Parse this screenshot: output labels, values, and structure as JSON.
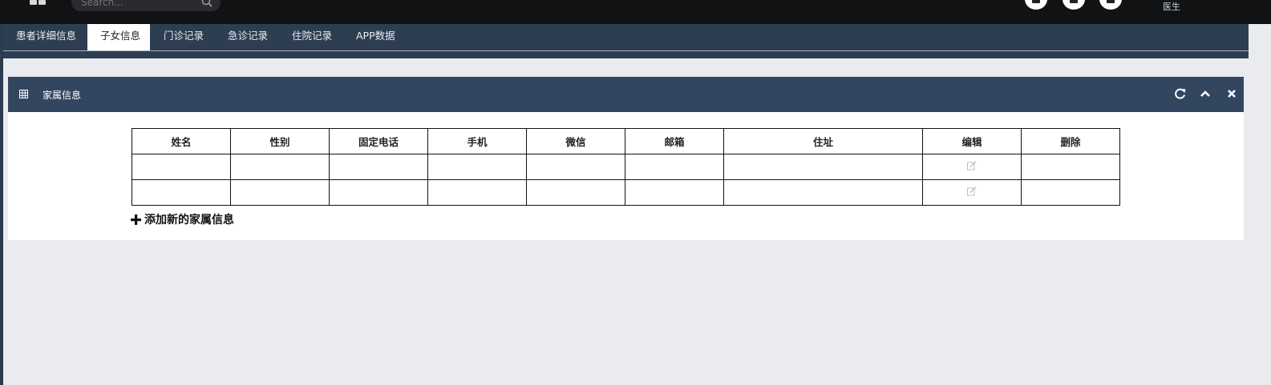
{
  "header": {
    "search_placeholder": "Search...",
    "user_role": "医生",
    "icons": [
      "grid-icon",
      "search-icon",
      "app-icon-1",
      "app-icon-2",
      "app-icon-3"
    ]
  },
  "tabs": [
    {
      "label": "患者详细信息",
      "active": false
    },
    {
      "label": "子女信息",
      "active": true
    },
    {
      "label": "门诊记录",
      "active": false
    },
    {
      "label": "急诊记录",
      "active": false
    },
    {
      "label": "住院记录",
      "active": false
    },
    {
      "label": "APP数据",
      "active": false
    }
  ],
  "panel": {
    "title": "家属信息",
    "icons": [
      "table-icon",
      "refresh-icon",
      "collapse-icon",
      "close-icon"
    ]
  },
  "table": {
    "columns": [
      "姓名",
      "性别",
      "固定电话",
      "手机",
      "微信",
      "邮箱",
      "住址",
      "编辑",
      "删除"
    ],
    "rows": [
      [
        "",
        "",
        "",
        "",
        "",
        "",
        "",
        "",
        ""
      ],
      [
        "",
        "",
        "",
        "",
        "",
        "",
        "",
        "",
        ""
      ]
    ],
    "edit_icon": "edit-icon"
  },
  "add_link": "添加新的家属信息",
  "colors": {
    "topbar": "#111214",
    "nav": "#2d3e52",
    "panel_header": "#33465f",
    "background": "#e9ebef"
  }
}
